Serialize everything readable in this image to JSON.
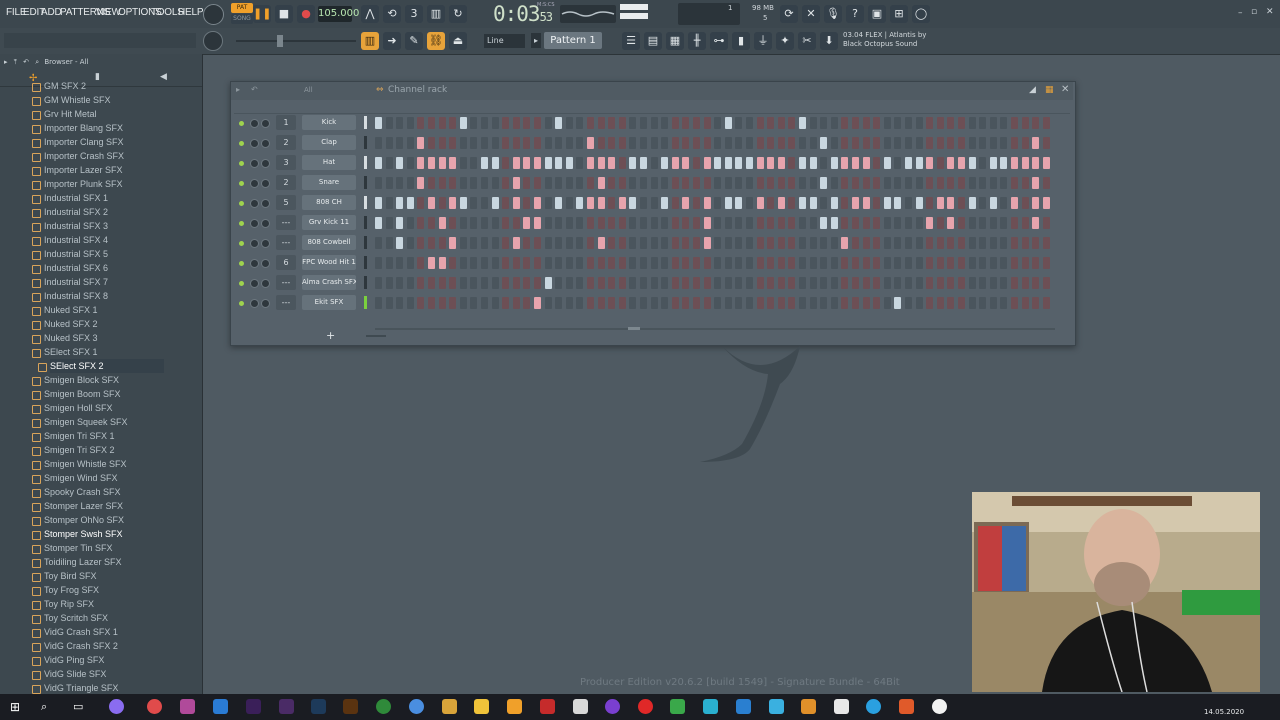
{
  "menu": [
    "FILE",
    "EDIT",
    "ADD",
    "PATTERNS",
    "VIEW",
    "OPTIONS",
    "TOOLS",
    "HELP"
  ],
  "transport": {
    "pat_song": "PAT",
    "song": "SONG",
    "bpm": "105.000",
    "time_main": "0:03",
    "time_sub": "53",
    "time_unit": "M:S:CS",
    "cpu_num": "1",
    "mem": "98 MB",
    "poly": "5"
  },
  "toolbar": {
    "snap": "Line",
    "pattern": "Pattern 1",
    "hint_line1": "03.04  FLEX | Atlantis by",
    "hint_line2": "Black Octopus Sound"
  },
  "browser": {
    "header": "Browser - All",
    "items": [
      "GM SFX 2",
      "GM Whistle SFX",
      "Grv Hit Metal",
      "Importer Blang SFX",
      "Importer Clang SFX",
      "Importer Crash SFX",
      "Importer Lazer SFX",
      "Importer Plunk SFX",
      "Industrial SFX 1",
      "Industrial SFX 2",
      "Industrial SFX 3",
      "Industrial SFX 4",
      "Industrial SFX 5",
      "Industrial SFX 6",
      "Industrial SFX 7",
      "Industrial SFX 8",
      "Nuked SFX 1",
      "Nuked SFX 2",
      "Nuked SFX 3",
      "SElect SFX 1",
      "SElect SFX 2",
      "Smigen Block SFX",
      "Smigen Boom SFX",
      "Smigen Holl SFX",
      "Smigen Squeek SFX",
      "Smigen Tri SFX 1",
      "Smigen Tri SFX 2",
      "Smigen Whistle SFX",
      "Smigen Wind SFX",
      "Spooky Crash SFX",
      "Stomper Lazer SFX",
      "Stomper OhNo SFX",
      "Stomper Swsh SFX",
      "Stomper Tin SFX",
      "Toidiling Lazer SFX",
      "Toy Bird SFX",
      "Toy Frog SFX",
      "Toy Rip SFX",
      "Toy Scritch SFX",
      "VidG Crash SFX 1",
      "VidG Crash SFX 2",
      "VidG Ping SFX",
      "VidG Slide SFX",
      "VidG Triangle SFX"
    ],
    "selected_index": 20,
    "highlighted_index": 32
  },
  "rack": {
    "title": "Channel rack",
    "filter": "All",
    "channels": [
      {
        "num": "1",
        "name": "Kick",
        "pattern": "1000000010000000010000000000000001000000100000000000000000000000"
      },
      {
        "num": "2",
        "name": "Clap",
        "pattern": "0000100000000000000010000000000000000000001000000000000000000010"
      },
      {
        "num": "3",
        "name": "Hat",
        "pattern": "1010111100110111111011101101110111111110110111101011101110111111"
      },
      {
        "num": "2",
        "name": "Snare",
        "pattern": "0000100000000100000001000000000000000000001000000000000000000010"
      },
      {
        "num": "5",
        "name": "808 CH",
        "pattern": "1011010110010101010111011001010101101010110101101101011010101011"
      },
      {
        "num": "---",
        "name": "Grv Kick 11",
        "pattern": "1010001000000011000000000000000100000000001100000000101000000010"
      },
      {
        "num": "---",
        "name": "808 Cowbell",
        "pattern": "0010000100000100000001000000000100000000000010000000000000000000"
      },
      {
        "num": "6",
        "name": "FPC Wood Hit 1",
        "pattern": "0000011000000000000000000000000000000000000000000000000000000000"
      },
      {
        "num": "---",
        "name": "Alma Crash SFX",
        "pattern": "0000000000000000100000000000000000000000000000000000000000000000"
      },
      {
        "num": "---",
        "name": "Ekit SFX",
        "pattern": "0000000000000001000000000000000000000000000000000100000000000000"
      }
    ]
  },
  "footer": "Producer Edition v20.6.2 [build 1549] - Signature Bundle - 64Bit",
  "taskbar": {
    "date": "14.05.2020"
  },
  "colors": {
    "accent": "#f0a02a",
    "step_on_pink": "#e7a4ad",
    "step_on_blue": "#c9d7e0",
    "led_green": "#9fd34e"
  }
}
